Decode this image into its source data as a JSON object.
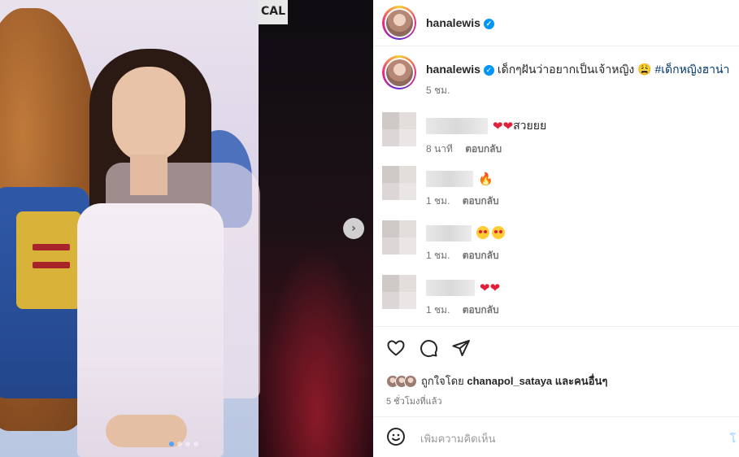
{
  "photo": {
    "sign_text": "CAL",
    "carousel_dots": 4,
    "active_dot": 1
  },
  "header": {
    "username": "hanalewis"
  },
  "caption": {
    "username": "hanalewis",
    "text": "เด็กๆฝันว่าอยากเป็นเจ้าหญิง 😩",
    "hashtag": "#เด็กหญิงฮาน่า",
    "time": "5 ชม."
  },
  "comments": [
    {
      "text": "สวยยย",
      "emoji": "❤❤",
      "time": "8 นาที",
      "reply": "ตอบกลับ"
    },
    {
      "text": "",
      "emoji": "🔥",
      "time": "1 ชม.",
      "reply": "ตอบกลับ"
    },
    {
      "text": "",
      "emoji": "😍😍",
      "time": "1 ชม.",
      "reply": "ตอบกลับ"
    },
    {
      "text": "",
      "emoji": "❤❤",
      "time": "1 ชม.",
      "reply": "ตอบกลับ"
    }
  ],
  "likes": {
    "prefix": "ถูกใจโดย",
    "user": "chanapol_sataya",
    "and_others": "และคนอื่นๆ"
  },
  "time_ago": "5 ชั่วโมงที่แล้ว",
  "add_comment": {
    "placeholder": "เพิ่มความคิดเห็น",
    "post_label": "โ"
  },
  "colors": {
    "verified": "#0095f6",
    "hashtag": "#00376b",
    "active_dot": "#4da3ff"
  },
  "icons": [
    "verified-icon",
    "heart-icon",
    "comment-icon",
    "share-icon",
    "emoji-icon",
    "chevron-right-icon"
  ]
}
